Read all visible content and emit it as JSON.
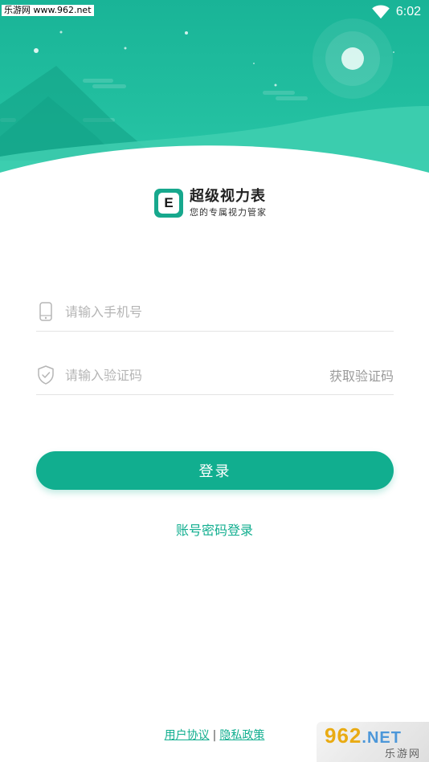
{
  "watermark": {
    "site": "乐游网 www.962.net",
    "badge_main": "962",
    "badge_net": ".NET",
    "badge_sub": "乐游网"
  },
  "status": {
    "time": "6:02"
  },
  "brand": {
    "logo_letter": "E",
    "title": "超级视力表",
    "subtitle": "您的专属视力管家"
  },
  "phone": {
    "placeholder": "请输入手机号",
    "value": ""
  },
  "code": {
    "placeholder": "请输入验证码",
    "value": "",
    "get_code_label": "获取验证码"
  },
  "login": {
    "label": "登录"
  },
  "alt_login": {
    "label": "账号密码登录"
  },
  "footer": {
    "terms": "用户协议",
    "separator": "|",
    "privacy": "隐私政策"
  },
  "colors": {
    "primary": "#11ae8f",
    "header": "#19b497",
    "placeholder": "#b5b5b5"
  },
  "icons": {
    "phone": "phone-icon",
    "shield": "shield-check-icon",
    "wifi": "wifi-icon"
  }
}
